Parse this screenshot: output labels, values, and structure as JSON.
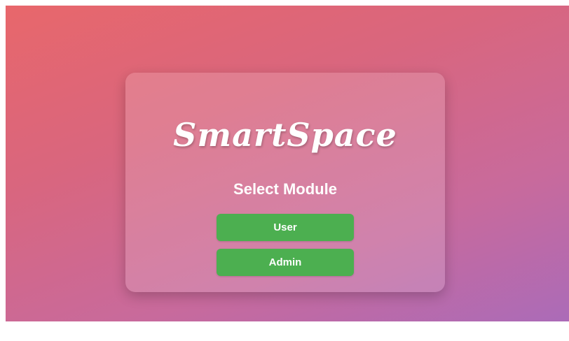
{
  "app": {
    "brand": "SmartSpace"
  },
  "module_select": {
    "heading": "Select Module",
    "buttons": [
      {
        "label": "User"
      },
      {
        "label": "Admin"
      }
    ]
  },
  "colors": {
    "gradient_start": "#e8676b",
    "gradient_end": "#ab6bb8",
    "button": "#4caf50",
    "text": "#ffffff"
  }
}
